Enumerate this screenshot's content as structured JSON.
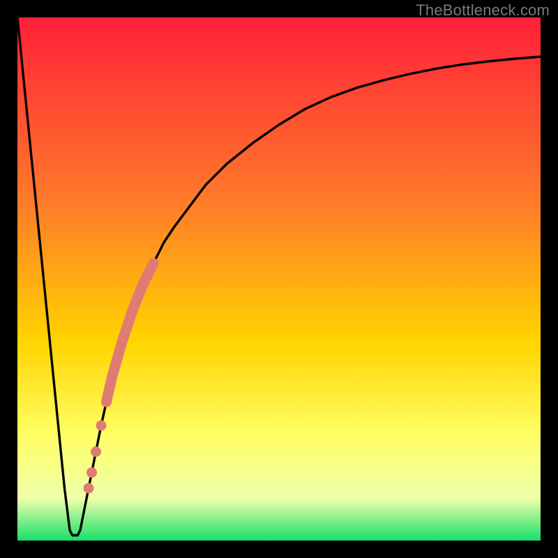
{
  "attribution": "TheBottleneck.com",
  "colors": {
    "gradient_top": "#ff2038",
    "gradient_mid1": "#ff7a2a",
    "gradient_mid2": "#ffd400",
    "gradient_mid3": "#ffff66",
    "gradient_mid4": "#eeffaa",
    "gradient_bottom": "#16e06a",
    "curve": "#000000",
    "marker": "#e07b73",
    "frame": "#000000"
  },
  "chart_data": {
    "type": "line",
    "title": "",
    "xlabel": "",
    "ylabel": "",
    "xlim": [
      0,
      100
    ],
    "ylim": [
      0,
      100
    ],
    "series": [
      {
        "name": "bottleneck-curve",
        "x": [
          0,
          2,
          4,
          6,
          8,
          9,
          10,
          10.5,
          11,
          11.5,
          12,
          14,
          16,
          18,
          20,
          22,
          24,
          26,
          28,
          30,
          33,
          36,
          40,
          45,
          50,
          55,
          60,
          65,
          70,
          75,
          80,
          85,
          90,
          95,
          100
        ],
        "y": [
          100,
          80,
          60,
          40,
          20,
          10,
          2,
          1,
          1,
          1,
          2,
          12,
          22,
          31,
          38,
          44,
          49,
          53,
          57,
          60,
          64,
          68,
          72,
          76,
          79.5,
          82.5,
          84.8,
          86.6,
          88,
          89.2,
          90.2,
          91,
          91.6,
          92.1,
          92.5
        ]
      }
    ],
    "markers_band": {
      "name": "highlighted-segment",
      "x_start": 17,
      "x_end": 26,
      "y_start": 27,
      "y_end": 53
    },
    "markers_dots": [
      {
        "x": 16.0,
        "y": 22
      },
      {
        "x": 15.0,
        "y": 17
      },
      {
        "x": 14.2,
        "y": 13
      },
      {
        "x": 13.6,
        "y": 10
      }
    ]
  }
}
